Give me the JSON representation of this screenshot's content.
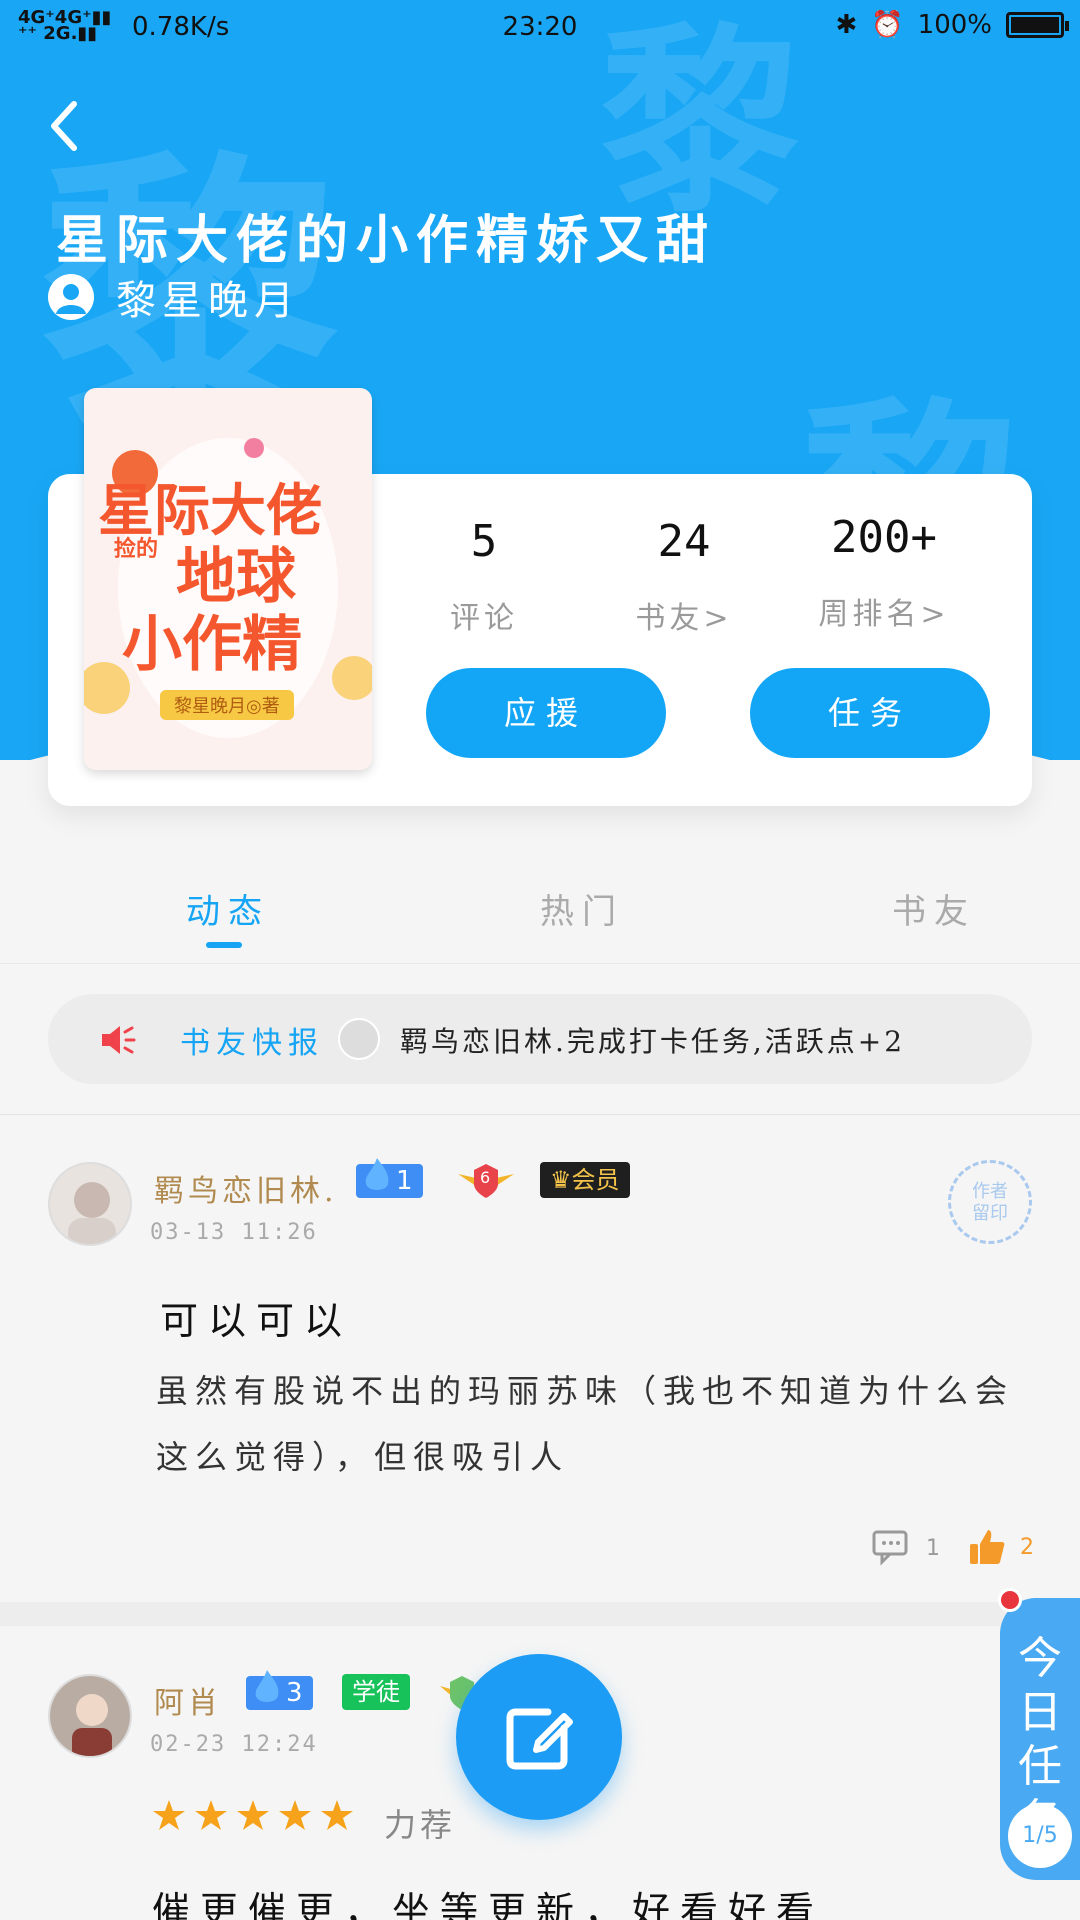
{
  "status_bar": {
    "signal": "4G⁺ 4G⁺\n2G.",
    "speed": "0.78K/s",
    "time": "23:20",
    "battery": "100%"
  },
  "header": {
    "watermark_char": "黎",
    "title": "星际大佬的小作精娇又甜",
    "author": "黎星晚月"
  },
  "book": {
    "cover": {
      "line1": "星际大佬",
      "small": "捡的",
      "line2": "地球",
      "line3": "小作精",
      "badge": "黎星晚月◎著"
    },
    "stats": [
      {
        "value": "5",
        "label": "评论"
      },
      {
        "value": "24",
        "label": "书友>"
      },
      {
        "value": "200+",
        "label": "周排名>"
      }
    ],
    "buttons": {
      "support": "应援",
      "task": "任务"
    }
  },
  "tabs": [
    {
      "label": "动态",
      "active": true
    },
    {
      "label": "热门",
      "active": false
    },
    {
      "label": "书友",
      "active": false
    }
  ],
  "news": {
    "label": "书友快报",
    "text": "羁鸟恋旧林.完成打卡任务,活跃点+2"
  },
  "posts": [
    {
      "user": "羁鸟恋旧林.",
      "level": "1",
      "rank_badge": "6",
      "member": "会员",
      "time": "03-13 11:26",
      "stamp": "作者\n留印",
      "headline": "可以可以",
      "body": "虽然有股说不出的玛丽苏味（我也不知道为什么会这么觉得），但很吸引人",
      "comments": "1",
      "likes": "2"
    },
    {
      "user": "阿肖",
      "level": "3",
      "role": "学徒",
      "time": "02-23 12:24",
      "rating": 5,
      "rating_text": "力荐",
      "body": "催更催更，坐等更新，好看好看"
    }
  ],
  "task_tab": {
    "label": "今日任务",
    "progress": "1/5"
  },
  "colors": {
    "primary": "#19a7f5",
    "accent_orange": "#f39a2a",
    "name_gold": "#b08a4f"
  }
}
